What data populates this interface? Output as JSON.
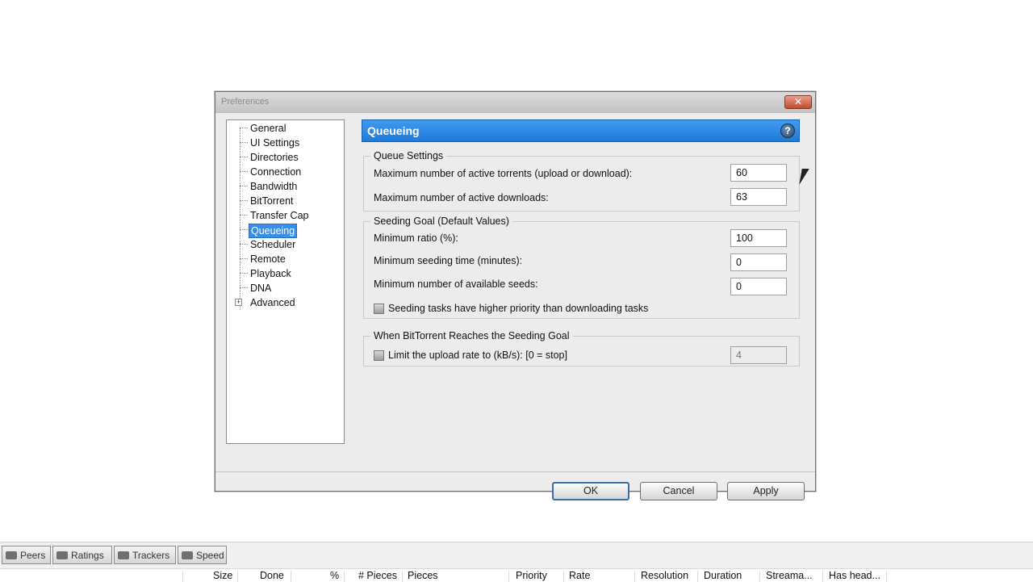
{
  "dialog": {
    "title": "Preferences",
    "close_glyph": "✕",
    "tree": {
      "items": [
        "General",
        "UI Settings",
        "Directories",
        "Connection",
        "Bandwidth",
        "BitTorrent",
        "Transfer Cap",
        "Queueing",
        "Scheduler",
        "Remote",
        "Playback",
        "DNA",
        "Advanced"
      ],
      "selected": "Queueing",
      "expander_glyph": "+"
    },
    "header": {
      "title": "Queueing",
      "help_glyph": "?"
    },
    "queue_settings": {
      "title": "Queue Settings",
      "max_active_torrents_label": "Maximum number of active torrents (upload or download):",
      "max_active_torrents_value": "60",
      "max_active_downloads_label": "Maximum number of active downloads:",
      "max_active_downloads_value": "63"
    },
    "seeding_goal": {
      "title": "Seeding Goal (Default Values)",
      "min_ratio_label": "Minimum ratio (%):",
      "min_ratio_value": "100",
      "min_seed_time_label": "Minimum seeding time (minutes):",
      "min_seed_time_value": "0",
      "min_seeds_label": "Minimum number of available seeds:",
      "min_seeds_value": "0",
      "priority_checkbox_label": "Seeding tasks have higher priority than downloading tasks"
    },
    "when_reached": {
      "title": "When BitTorrent Reaches the Seeding Goal",
      "limit_checkbox_label": "Limit the upload rate to (kB/s): [0 = stop]",
      "limit_value": "4"
    },
    "buttons": {
      "ok": "OK",
      "cancel": "Cancel",
      "apply": "Apply"
    }
  },
  "bottom": {
    "tabs": [
      "Peers",
      "Ratings",
      "Trackers",
      "Speed"
    ],
    "columns": [
      "Size",
      "Done",
      "%",
      "# Pieces",
      "Pieces",
      "Priority",
      "Rate",
      "Resolution",
      "Duration",
      "Streama...",
      "Has head..."
    ]
  }
}
